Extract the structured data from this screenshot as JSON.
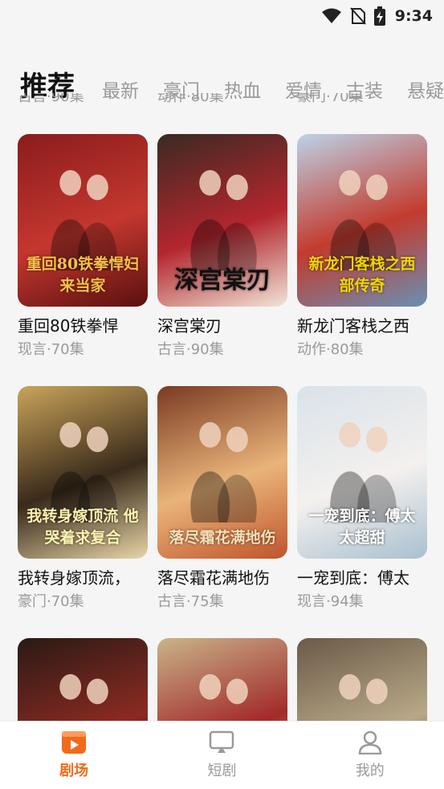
{
  "status": {
    "time": "9:34"
  },
  "tabs": [
    "推荐",
    "最新",
    "豪门",
    "热血",
    "爱情",
    "古装",
    "悬疑"
  ],
  "peek_meta": [
    "古言·90集",
    "动作·80集",
    "豪门·70集"
  ],
  "dramas": [
    {
      "name": "重回80铁拳悍",
      "meta": "现言·70集",
      "poster_text": "重回80铁拳悍妇来当家",
      "colors": [
        "#8a1c1c",
        "#c4372f",
        "#5a1010"
      ],
      "text_color": "#f6c04a"
    },
    {
      "name": "深宫棠刃",
      "meta": "古言·90集",
      "poster_text": "深宫棠刃",
      "colors": [
        "#3a2a22",
        "#b4262e",
        "#efe6d8"
      ],
      "text_color": "#111111"
    },
    {
      "name": "新龙门客栈之西",
      "meta": "动作·80集",
      "poster_text": "新龙门客栈之西部传奇",
      "colors": [
        "#bcd3e8",
        "#c23b2e",
        "#6a8fb3"
      ],
      "text_color": "#f2d400"
    },
    {
      "name": "我转身嫁顶流，",
      "meta": "豪门·70集",
      "poster_text": "我转身嫁顶流 他哭着求复合",
      "colors": [
        "#c9a45a",
        "#3a2a1a",
        "#e8d6a8"
      ],
      "text_color": "#fff2b0"
    },
    {
      "name": "落尽霜花满地伤",
      "meta": "古言·75集",
      "poster_text": "落尽霜花满地伤",
      "colors": [
        "#7a3a22",
        "#e9b47a",
        "#c0542c"
      ],
      "text_color": "#f5e0b8"
    },
    {
      "name": "一宠到底：傅太",
      "meta": "现言·94集",
      "poster_text": "一宠到底：傅太太超甜",
      "colors": [
        "#d9e3ea",
        "#f4f0ee",
        "#a9c0cf"
      ],
      "text_color": "#ffffff"
    },
    {
      "name": "",
      "meta": "",
      "poster_text": "",
      "colors": [
        "#2a1a14",
        "#8a2a22",
        "#1a0e0a"
      ],
      "text_color": "#ffffff"
    },
    {
      "name": "",
      "meta": "",
      "poster_text": "",
      "colors": [
        "#c8b48a",
        "#a22a2a",
        "#e6d6b6"
      ],
      "text_color": "#ffffff"
    },
    {
      "name": "",
      "meta": "",
      "poster_text": "",
      "colors": [
        "#6a5a48",
        "#b8a888",
        "#3a3228"
      ],
      "text_color": "#ffffff"
    }
  ],
  "bottom_nav": [
    {
      "label": "剧场",
      "icon": "theater-icon",
      "active": true
    },
    {
      "label": "短剧",
      "icon": "tv-play-icon",
      "active": false
    },
    {
      "label": "我的",
      "icon": "person-icon",
      "active": false
    }
  ],
  "accent": "#f26a1b"
}
